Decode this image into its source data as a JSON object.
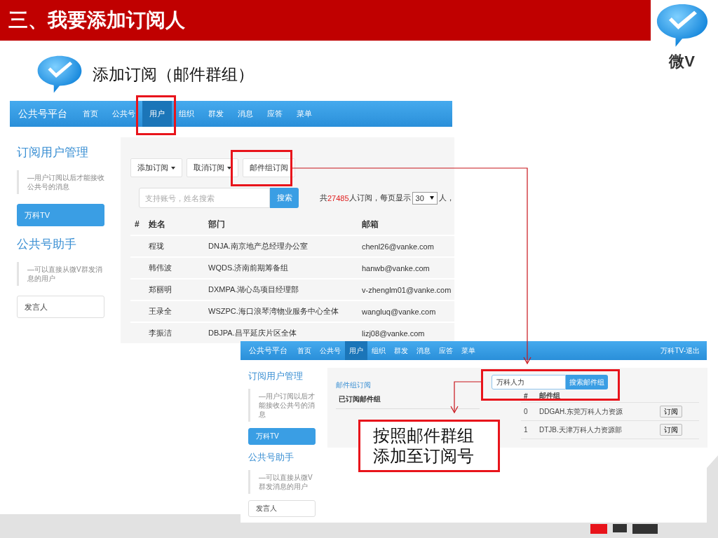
{
  "header": {
    "title": "三、我要添加订阅人"
  },
  "logo": {
    "text": "微V"
  },
  "subtitle": "添加订阅（邮件群组）",
  "user_screen": {
    "nav": {
      "brand": "公共号平台",
      "items": [
        {
          "label": "首页",
          "selected": false
        },
        {
          "label": "公共号",
          "selected": false
        },
        {
          "label": "用户",
          "selected": true
        },
        {
          "label": "组织",
          "selected": false
        },
        {
          "label": "群发",
          "selected": false
        },
        {
          "label": "消息",
          "selected": false
        },
        {
          "label": "应答",
          "selected": false
        },
        {
          "label": "菜单",
          "selected": false
        }
      ]
    },
    "sidebar": [
      {
        "kind": "heading",
        "text": "订阅用户管理"
      },
      {
        "kind": "note",
        "text": "—用户订阅以后才能接收公共号的消息"
      },
      {
        "kind": "account",
        "text": "万科TV",
        "selected": true
      },
      {
        "kind": "heading",
        "text": "公共号助手"
      },
      {
        "kind": "note",
        "text": "—可以直接从微V群发消息的用户"
      },
      {
        "kind": "account",
        "text": "发言人",
        "selected": false
      }
    ],
    "toolbar": [
      {
        "label": "添加订阅",
        "dropdown": true
      },
      {
        "label": "取消订阅",
        "dropdown": true
      },
      {
        "label": "邮件组订阅",
        "dropdown": false
      }
    ],
    "search": {
      "placeholder": "支持账号，姓名搜索",
      "button": "搜索"
    },
    "summary": {
      "prefix": "共",
      "count": "27485",
      "middle": "人订阅，每页显示",
      "page_size": "30",
      "suffix": "人，"
    },
    "table": {
      "columns": [
        "#",
        "姓名",
        "部门",
        "邮箱"
      ],
      "rows": [
        {
          "name": "程珑",
          "department": "DNJA.南京地产总经理办公室",
          "email": "chenl26@vanke.com"
        },
        {
          "name": "韩伟波",
          "department": "WQDS.济南前期筹备组",
          "email": "hanwb@vanke.com"
        },
        {
          "name": "郑丽明",
          "department": "DXMPA.湖心岛项目经理部",
          "email": "v-zhenglm01@vanke.com"
        },
        {
          "name": "王录全",
          "department": "WSZPC.海口浪琴湾物业服务中心全体",
          "email": "wangluq@vanke.com"
        },
        {
          "name": "李振洁",
          "department": "DBJPA.昌平延庆片区全体",
          "email": "lizj08@vanke.com"
        }
      ]
    }
  },
  "group_screen": {
    "nav": {
      "brand": "公共号平台",
      "items": [
        {
          "label": "首页",
          "selected": false
        },
        {
          "label": "公共号",
          "selected": false
        },
        {
          "label": "用户",
          "selected": true
        },
        {
          "label": "组织",
          "selected": false
        },
        {
          "label": "群发",
          "selected": false
        },
        {
          "label": "消息",
          "selected": false
        },
        {
          "label": "应答",
          "selected": false
        },
        {
          "label": "菜单",
          "selected": false
        }
      ],
      "user_link": "万科TV-退出"
    },
    "sidebar": [
      {
        "kind": "heading",
        "text": "订阅用户管理"
      },
      {
        "kind": "note",
        "text": "—用户订阅以后才能接收公共号的消息"
      },
      {
        "kind": "account",
        "text": "万科TV",
        "selected": true
      },
      {
        "kind": "heading",
        "text": "公共号助手"
      },
      {
        "kind": "note",
        "text": "—可以直接从微V群发消息的用户"
      },
      {
        "kind": "account",
        "text": "发言人",
        "selected": false
      }
    ],
    "panel_title": "邮件组订阅",
    "subscribed_column": "已订阅邮件组",
    "search": {
      "value": "万科人力",
      "button": "搜索邮件组"
    },
    "table": {
      "columns": [
        "#",
        "邮件组"
      ],
      "rows": [
        {
          "index": "0",
          "group": "DDGAH.东莞万科人力资源",
          "action": "订阅"
        },
        {
          "index": "1",
          "group": "DTJB.天津万科人力资源部",
          "action": "订阅"
        }
      ]
    }
  },
  "callout": {
    "lines": [
      "按照邮件群组",
      "添加至订阅号"
    ]
  }
}
